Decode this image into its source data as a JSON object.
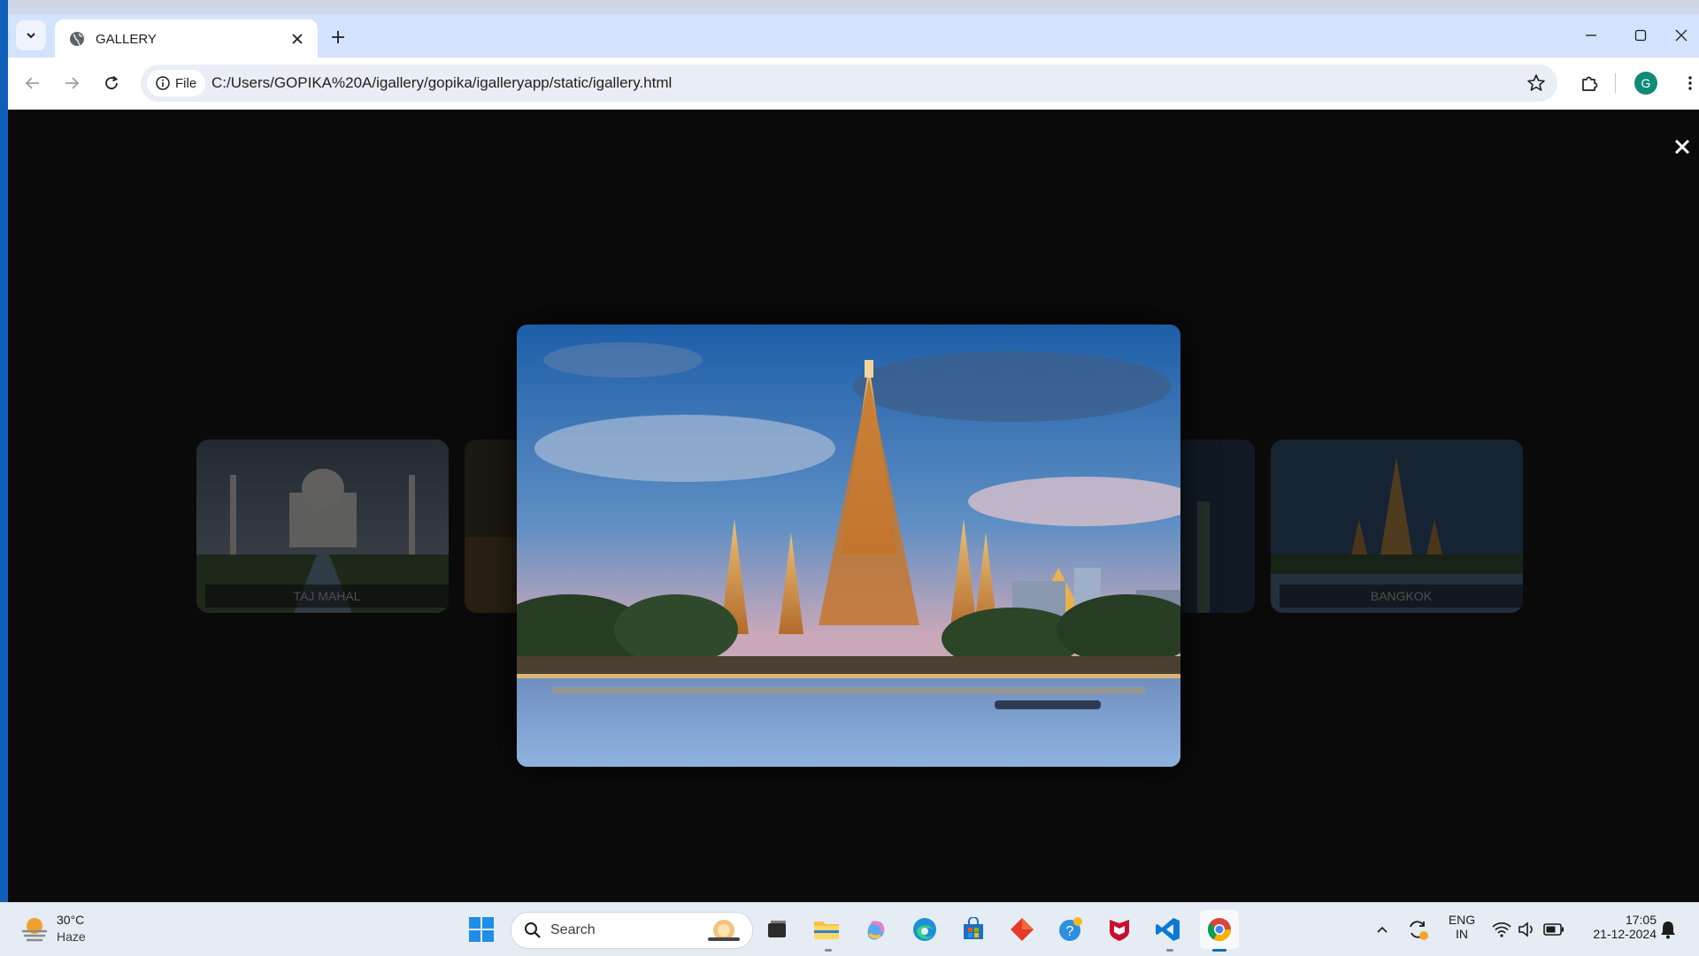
{
  "browser": {
    "tab_title": "GALLERY",
    "security_chip": "File",
    "url": "C:/Users/GOPIKA%20A/igallery/gopika/igalleryapp/static/igallery.html",
    "profile_initial": "G"
  },
  "gallery": {
    "cards": [
      {
        "caption": "TAJ MAHAL"
      },
      {
        "caption": "BANGKOK"
      }
    ],
    "lightbox_subject": "Bangkok temple at dusk"
  },
  "taskbar": {
    "weather": {
      "temp": "30°C",
      "condition": "Haze"
    },
    "search_label": "Search",
    "tray": {
      "lang_top": "ENG",
      "lang_bottom": "IN"
    },
    "clock": {
      "time": "17:05",
      "date": "21-12-2024"
    }
  },
  "colors": {
    "tabstrip": "#d3e3fd",
    "page_bg": "#0a0a0a",
    "taskbar_bg": "#e6ecf4",
    "accent": "#0f6cbd"
  }
}
